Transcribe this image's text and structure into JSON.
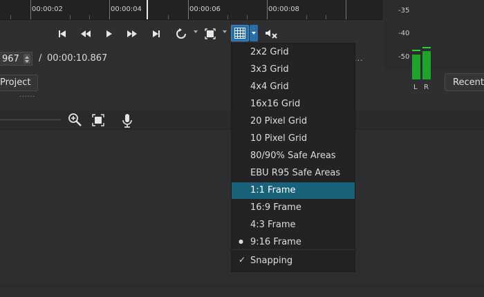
{
  "ruler": {
    "labels": [
      "00:00:02",
      "00:00:04",
      "00:00:06",
      "00:00:08"
    ]
  },
  "meter": {
    "db_labels": [
      "-35",
      "-40",
      "-50"
    ],
    "left_label": "L",
    "right_label": "R",
    "accent": "#1fa32b"
  },
  "timecode": {
    "current_value": "967",
    "separator": "/",
    "total": "00:00:10.867",
    "trailing_dots": "..."
  },
  "tabs": {
    "project": "Project",
    "recent": "Recent"
  },
  "grid_menu": {
    "items": [
      {
        "label": "2x2 Grid",
        "state": ""
      },
      {
        "label": "3x3 Grid",
        "state": ""
      },
      {
        "label": "4x4 Grid",
        "state": ""
      },
      {
        "label": "16x16 Grid",
        "state": ""
      },
      {
        "label": "20 Pixel Grid",
        "state": ""
      },
      {
        "label": "10 Pixel Grid",
        "state": ""
      },
      {
        "label": "80/90% Safe Areas",
        "state": ""
      },
      {
        "label": "EBU R95 Safe Areas",
        "state": ""
      },
      {
        "label": "1:1 Frame",
        "state": "highlighted"
      },
      {
        "label": "16:9 Frame",
        "state": ""
      },
      {
        "label": "4:3 Frame",
        "state": ""
      },
      {
        "label": "9:16 Frame",
        "state": "selected"
      },
      {
        "label": "Snapping",
        "state": "checked"
      }
    ],
    "bullet": "●",
    "check": "✓",
    "highlight_color": "#19627a"
  },
  "icons": {
    "transport": [
      "skip-to-start-icon",
      "rewind-icon",
      "play-icon",
      "fast-forward-icon",
      "skip-to-end-icon",
      "loop-icon",
      "zoom-fit-icon",
      "grid-icon",
      "mute-icon"
    ],
    "timeline_toolbar": [
      "zoom-in-icon",
      "zoom-fit-icon",
      "microphone-icon"
    ]
  }
}
